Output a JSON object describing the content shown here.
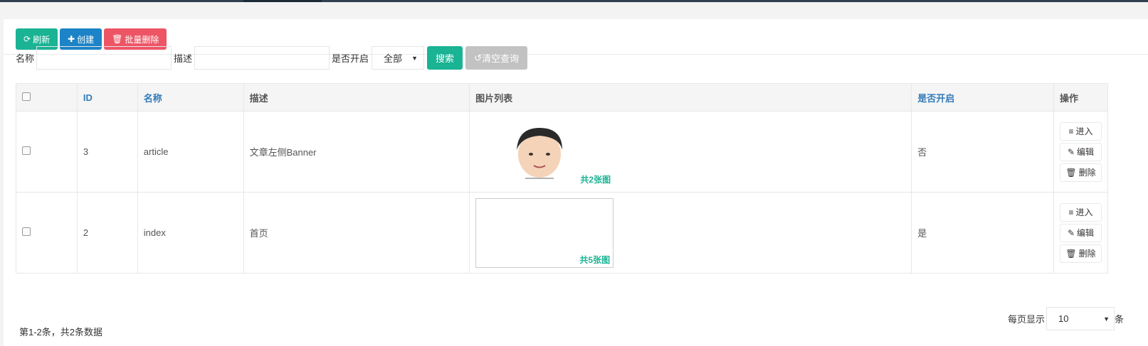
{
  "toolbar": {
    "refresh": "刷新",
    "create": "创建",
    "batch_delete": "批量删除"
  },
  "search": {
    "name_label": "名称",
    "name_value": "",
    "desc_label": "描述",
    "desc_value": "",
    "enabled_label": "是否开启",
    "enabled_value": "全部",
    "search_btn": "搜索",
    "clear_btn": "清空查询"
  },
  "table": {
    "headers": [
      "ID",
      "名称",
      "描述",
      "图片列表",
      "是否开启",
      "操作"
    ],
    "rows": [
      {
        "id": "3",
        "name": "article",
        "desc": "文章左侧Banner",
        "images": "共2张图",
        "enabled": "否"
      },
      {
        "id": "2",
        "name": "index",
        "desc": "首页",
        "images": "共5张图",
        "enabled": "是"
      }
    ],
    "actions": {
      "enter": "进入",
      "edit": "编辑",
      "delete": "删除"
    }
  },
  "footer": {
    "summary": "第1-2条，共2条数据",
    "per_page_label": "每页显示",
    "per_page_value": "10",
    "per_page_suffix": "条"
  }
}
